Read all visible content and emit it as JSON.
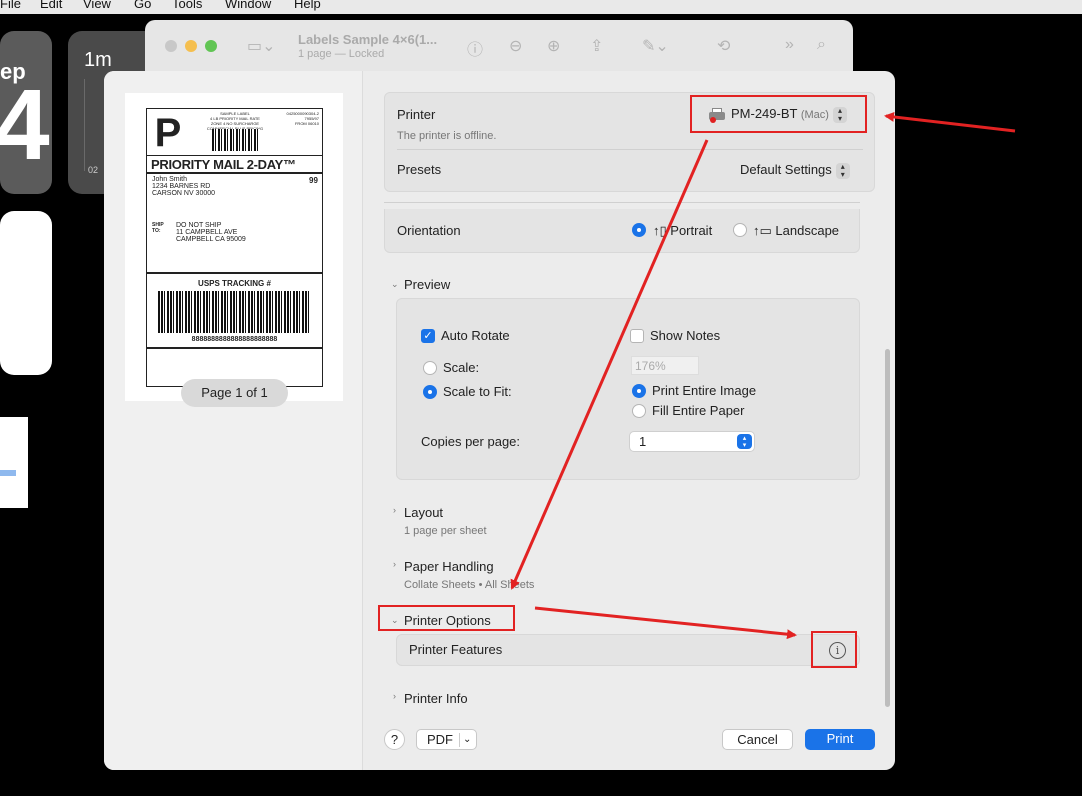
{
  "menubar": [
    "File",
    "Edit",
    "View",
    "Go",
    "Tools",
    "Window",
    "Help"
  ],
  "bg": {
    "tile_a_small": "ep",
    "tile_a_big": "4",
    "tile_b_small": "1m",
    "tile_b_tiny": "02"
  },
  "preview_window": {
    "title": "Labels Sample 4×6(1...",
    "subtitle": "1 page — Locked"
  },
  "label": {
    "letter": "P",
    "top_center": "SAMPLE LABEL\n4 LB PRIORITY MAIL RATE\nZONE 4 NO SURCHARGE\nCOMMERCIAL PLUS PRICING",
    "top_right": "0425000090304-2\n7955/97\nFROM 06010",
    "service": "PRIORITY MAIL 2-DAY™",
    "sender": "John Smith\n1234 BARNES RD\nCARSON NV 30000",
    "code": "99",
    "ship_to_label": "SHIP\nTO:",
    "ship_to": "DO NOT SHIP\n11 CAMPBELL AVE\nCAMPBELL CA 95009",
    "tracking_title": "USPS TRACKING #",
    "tracking_number": "8888888888888888888888"
  },
  "page_indicator": "Page 1 of 1",
  "printer": {
    "label": "Printer",
    "status": "The printer is offline.",
    "name": "PM-249-BT",
    "suffix": "(Mac)"
  },
  "presets": {
    "label": "Presets",
    "value": "Default Settings"
  },
  "orientation": {
    "label": "Orientation",
    "portrait": "Portrait",
    "landscape": "Landscape",
    "selected": "Portrait"
  },
  "preview_section": {
    "title": "Preview",
    "auto_rotate": "Auto Rotate",
    "auto_rotate_checked": true,
    "show_notes": "Show Notes",
    "show_notes_checked": false,
    "scale": "Scale:",
    "scale_value": "176%",
    "scale_to_fit": "Scale to Fit:",
    "print_entire_image": "Print Entire Image",
    "fill_entire_paper": "Fill Entire Paper",
    "copies_per_page": "Copies per page:",
    "copies_value": "1"
  },
  "layout": {
    "title": "Layout",
    "summary": "1 page per sheet"
  },
  "paper_handling": {
    "title": "Paper Handling",
    "summary": "Collate Sheets • All Sheets"
  },
  "printer_options": {
    "title": "Printer Options",
    "features": "Printer Features"
  },
  "printer_info": {
    "title": "Printer Info"
  },
  "buttons": {
    "help": "?",
    "pdf": "PDF",
    "cancel": "Cancel",
    "print": "Print"
  },
  "colors": {
    "accent": "#1a73e8",
    "annotation": "#e22222"
  }
}
